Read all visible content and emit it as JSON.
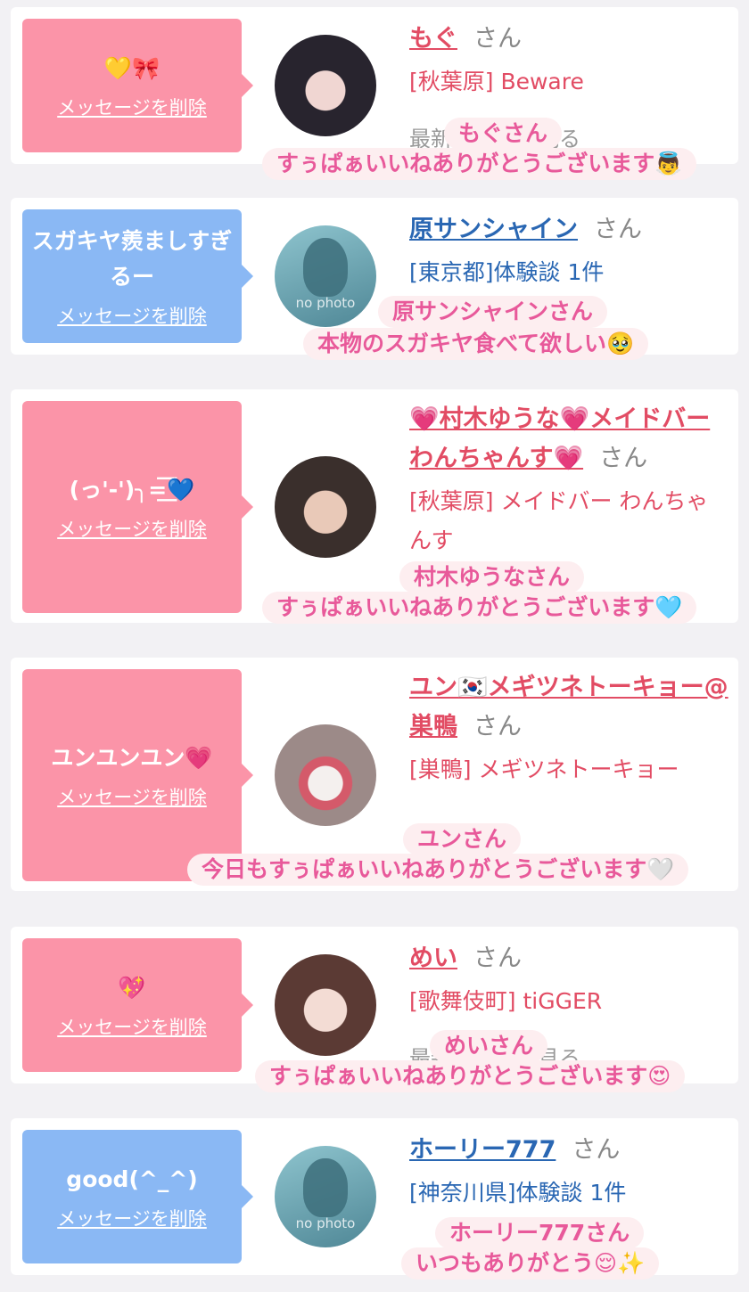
{
  "delete_label": "メッセージを削除",
  "san_label": "さん",
  "faded_text": "最新の投稿を見る",
  "colors": {
    "pink_bubble": "#fb94a8",
    "blue_bubble": "#8ab8f4",
    "pink_name": "#e24c64",
    "blue_name": "#2a67b3",
    "caption_text": "#e8599a"
  },
  "cards": [
    {
      "message": "💛🎀",
      "name": "もぐ",
      "sub": "[秋葉原] Beware",
      "caption_name": "もぐさん",
      "caption_text": "すぅぱぁいいねありがとうございます👼"
    },
    {
      "message": "スガキヤ羨ましすぎるー",
      "name": "原サンシャイン",
      "sub": "[東京都]体験談 1件",
      "caption_name": "原サンシャインさん",
      "caption_text": "本物のスガキヤ食べて欲しい🥹",
      "avatar_text": "no photo"
    },
    {
      "message": "(っ'-')╮=͟͟͞͞💙",
      "name": "💗村木ゆうな💗メイドバーわんちゃんす💗",
      "sub": "[秋葉原] メイドバー わんちゃんす",
      "caption_name": "村木ゆうなさん",
      "caption_text": "すぅぱぁいいねありがとうございます🩵"
    },
    {
      "message": "ユンユンユン💗",
      "name": "ユン🇰🇷メギツネトーキョー@巣鴨",
      "sub": "[巣鴨] メギツネトーキョー",
      "caption_name": "ユンさん",
      "caption_text": "今日もすぅぱぁいいねありがとうございます🤍"
    },
    {
      "message": "💖",
      "name": "めい",
      "sub": "[歌舞伎町] tiGGER",
      "caption_name": "めいさん",
      "caption_text": "すぅぱぁいいねありがとうございます😍"
    },
    {
      "message": "good(^_^)",
      "name": "ホーリー777",
      "sub": "[神奈川県]体験談 1件",
      "caption_name": "ホーリー777さん",
      "caption_text": "いつもありがとう😌✨",
      "avatar_text": "no photo"
    }
  ]
}
